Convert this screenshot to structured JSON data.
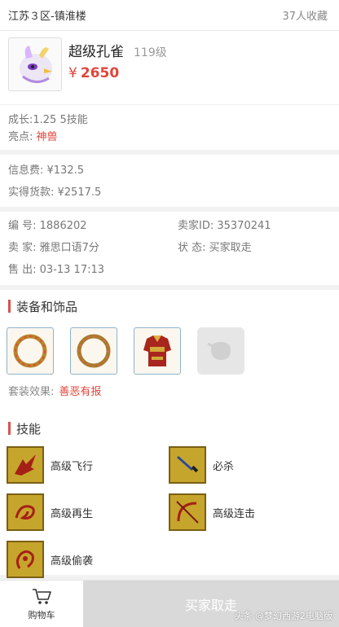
{
  "header": {
    "server": "江苏３区-镇淮楼",
    "collect_count": "37人收藏"
  },
  "pet": {
    "name": "超级孔雀",
    "level": "119级",
    "currency": "¥",
    "price": "2650"
  },
  "attrs": {
    "growth_skills": "成长:1.25 5技能",
    "highlight_label": "亮点:",
    "highlight_value": "神兽"
  },
  "fees": {
    "info_fee": "信息费: ¥132.5",
    "net_payment": "实得货款: ¥2517.5"
  },
  "trade": {
    "id": "编 号: 1886202",
    "seller_id": "卖家ID: 35370241",
    "seller": "卖 家: 雅思口语7分",
    "status": "状 态: 买家取走",
    "sold": "售 出: 03-13 17:13"
  },
  "equip": {
    "title": "装备和饰品",
    "items": [
      "ring-1",
      "ring-2",
      "armor",
      "empty"
    ],
    "suit_label": "套装效果:",
    "suit_value": "善恶有报"
  },
  "skills": {
    "title": "技能",
    "items": [
      {
        "name": "高级飞行",
        "icon": "wing-icon"
      },
      {
        "name": "必杀",
        "icon": "sword-icon"
      },
      {
        "name": "高级再生",
        "icon": "regen-icon"
      },
      {
        "name": "高级连击",
        "icon": "bow-icon"
      },
      {
        "name": "高级偷袭",
        "icon": "sneak-icon"
      }
    ]
  },
  "bottom": {
    "cart_label": "购物车",
    "buy_label": "买家取走"
  },
  "watermark": "头条 @梦幻西游2电脑版",
  "colors": {
    "price_red": "#e0463c",
    "accent_bar": "#d9534f",
    "buy_disabled": "#d9d9d9",
    "skill_gold": "#c6a52c"
  }
}
